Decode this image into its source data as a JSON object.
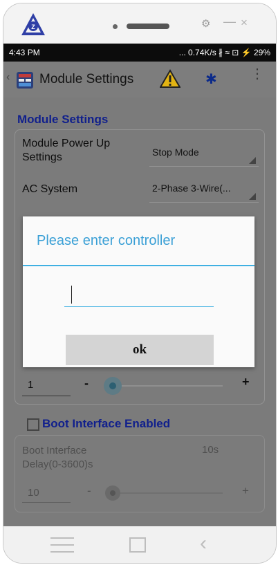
{
  "window": {
    "gear_icon": "gear-icon",
    "minimize": "—",
    "close": "×"
  },
  "statusbar": {
    "time": "4:43 PM",
    "right": "... 0.74K/s ∦ ≈ ⊡ ⚡ 29%"
  },
  "appbar": {
    "back": "‹",
    "title": "Module Settings",
    "bluetooth": "✱",
    "more": "⋮"
  },
  "main": {
    "section_title": "Module Settings",
    "rows": [
      {
        "label": "Module Power Up Settings",
        "value": "Stop Mode"
      },
      {
        "label": "AC System",
        "value": "2-Phase 3-Wire(..."
      }
    ],
    "stepper": {
      "value": "1",
      "minus": "-",
      "plus": "+",
      "slider_fraction": 0.0
    },
    "boot_interface_enabled": {
      "label": "Boot Interface Enabled",
      "checked": false
    },
    "boot_delay": {
      "label": "Boot Interface Delay(0-3600)s",
      "current": "10s",
      "value": "10",
      "minus": "-",
      "plus": "+",
      "slider_fraction": 0.0
    }
  },
  "dialog": {
    "title": "Please enter controller",
    "input_value": "",
    "ok_label": "ok"
  },
  "colors": {
    "accent": "#3fb0e2",
    "section_blue": "#11208c",
    "overlay_gray": "#7b7b7b"
  }
}
